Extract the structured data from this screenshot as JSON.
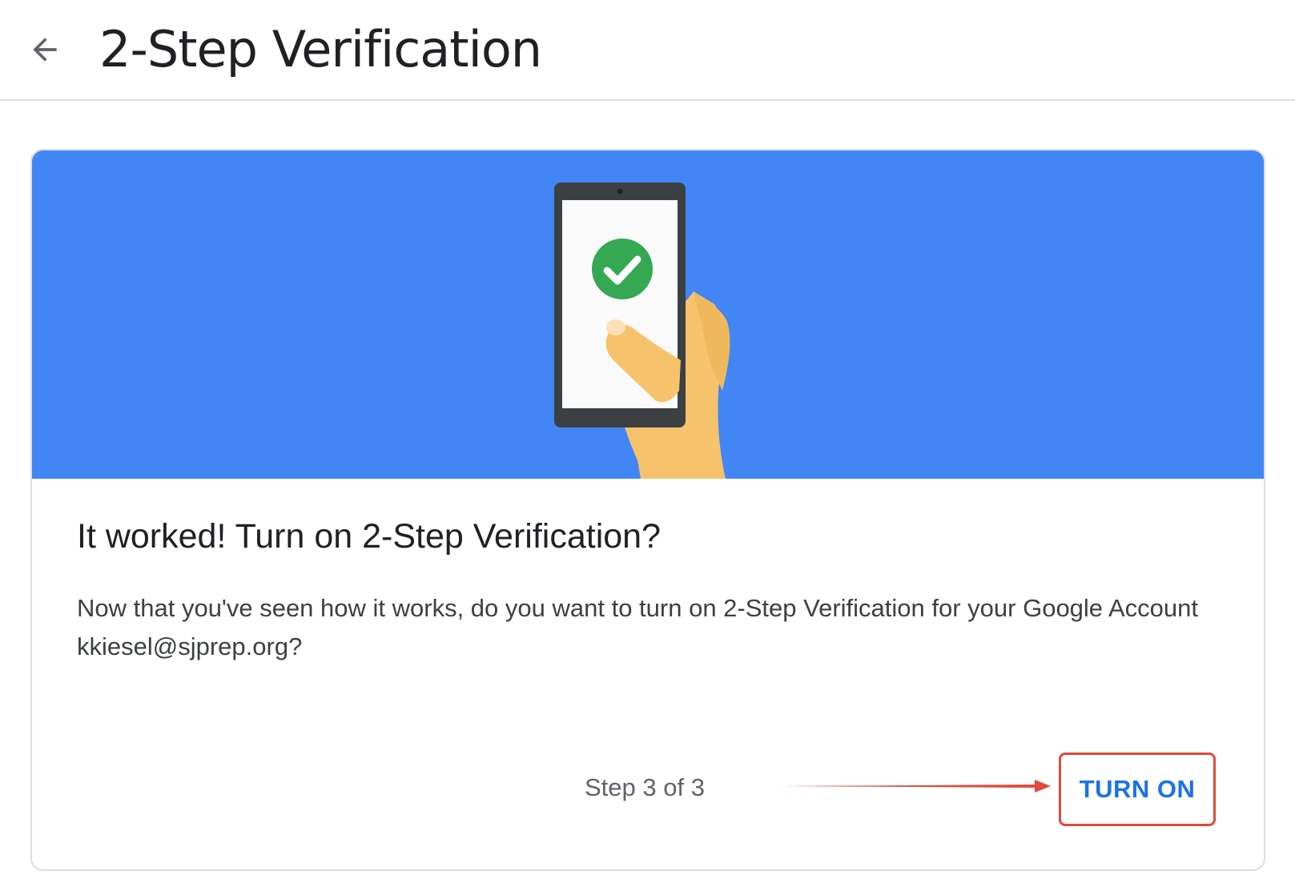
{
  "header": {
    "back_icon": "arrow-left-icon",
    "title": "2-Step Verification"
  },
  "card": {
    "hero_illustration": "phone-in-hand-checkmark",
    "colors": {
      "hero_background": "#4285f4",
      "check_green": "#34a853",
      "accent_red": "#e04a3c",
      "button_text": "#1a73e8"
    },
    "heading": "It worked! Turn on 2-Step Verification?",
    "body": "Now that you've seen how it works, do you want to turn on 2-Step Verification for your Google Account kkiesel@sjprep.org?",
    "step_indicator": "Step 3 of 3",
    "turn_on_label": "TURN ON"
  }
}
